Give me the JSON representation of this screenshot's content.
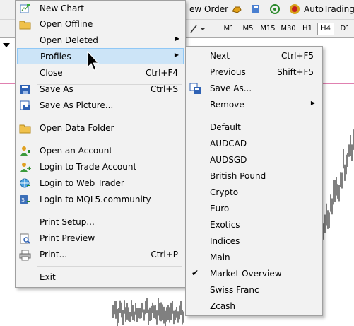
{
  "toolbar": {
    "new_order_label": "ew Order",
    "autotrading_label": "AutoTrading",
    "timeframes": [
      "M1",
      "M5",
      "M15",
      "M30",
      "H1",
      "H4",
      "D1"
    ],
    "active_timeframe": "H4"
  },
  "colors": {
    "menu_bg": "#f2f2f2",
    "highlight_bg": "#cce4f7",
    "highlight_border": "#90c8f6",
    "chart_line": "#c00060",
    "candles": "#000000"
  },
  "file_menu": {
    "items": [
      {
        "label": "New Chart",
        "shortcut": "",
        "icon": "new-chart-icon"
      },
      {
        "label": "Open Offline",
        "shortcut": "",
        "icon": "folder-icon"
      },
      {
        "label": "Open Deleted",
        "shortcut": "",
        "submenu": true
      },
      {
        "label": "Profiles",
        "shortcut": "",
        "submenu": true,
        "highlighted": true
      },
      {
        "label": "Close",
        "shortcut": "Ctrl+F4"
      },
      {
        "label": "Save As",
        "shortcut": "Ctrl+S",
        "icon": "floppy-icon"
      },
      {
        "label": "Save As Picture...",
        "shortcut": "",
        "icon": "save-picture-icon"
      },
      {
        "label": "Open Data Folder",
        "shortcut": "",
        "icon": "folder-icon"
      },
      {
        "label": "Open an Account",
        "shortcut": "",
        "icon": "user-add-icon"
      },
      {
        "label": "Login to Trade Account",
        "shortcut": "",
        "icon": "user-login-icon"
      },
      {
        "label": "Login to Web Trader",
        "shortcut": "",
        "icon": "web-login-icon"
      },
      {
        "label": "Login to MQL5.community",
        "shortcut": "",
        "icon": "mql5-login-icon"
      },
      {
        "label": "Print Setup...",
        "shortcut": ""
      },
      {
        "label": "Print Preview",
        "shortcut": "",
        "icon": "print-preview-icon"
      },
      {
        "label": "Print...",
        "shortcut": "Ctrl+P",
        "icon": "printer-icon"
      },
      {
        "label": "Exit",
        "shortcut": ""
      }
    ]
  },
  "profiles_menu": {
    "items": [
      {
        "label": "Next",
        "shortcut": "Ctrl+F5"
      },
      {
        "label": "Previous",
        "shortcut": "Shift+F5"
      },
      {
        "label": "Save As...",
        "shortcut": "",
        "icon": "save-profile-icon"
      },
      {
        "label": "Remove",
        "shortcut": "",
        "submenu": true
      },
      {
        "label": "Default",
        "shortcut": ""
      },
      {
        "label": "AUDCAD",
        "shortcut": ""
      },
      {
        "label": "AUDSGD",
        "shortcut": ""
      },
      {
        "label": "British Pound",
        "shortcut": ""
      },
      {
        "label": "Crypto",
        "shortcut": ""
      },
      {
        "label": "Euro",
        "shortcut": ""
      },
      {
        "label": "Exotics",
        "shortcut": ""
      },
      {
        "label": "Indices",
        "shortcut": ""
      },
      {
        "label": "Main",
        "shortcut": ""
      },
      {
        "label": "Market Overview",
        "shortcut": "",
        "checked": true
      },
      {
        "label": "Swiss Franc",
        "shortcut": ""
      },
      {
        "label": "Zcash",
        "shortcut": ""
      }
    ]
  }
}
